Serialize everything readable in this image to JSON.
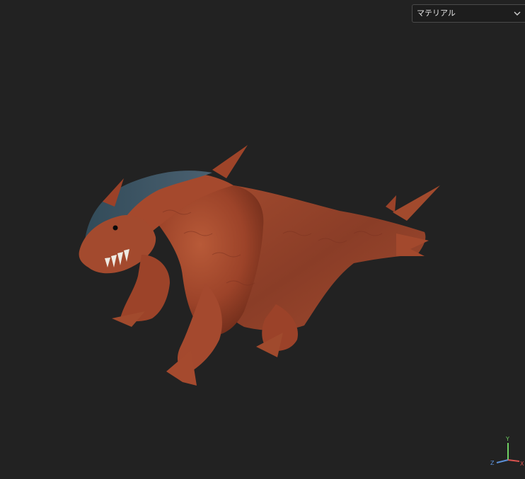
{
  "material_select": {
    "selected": "マテリアル",
    "icon": "chevron-down-icon"
  },
  "axis_gizmo": {
    "x_label": "X",
    "y_label": "Y",
    "z_label": "Z",
    "x_color": "#d9534f",
    "y_color": "#6fcf62",
    "z_color": "#5b8fd6"
  },
  "model": {
    "body_color": "#a4492e",
    "crest_color": "#3d5868",
    "background_color": "#222222"
  }
}
